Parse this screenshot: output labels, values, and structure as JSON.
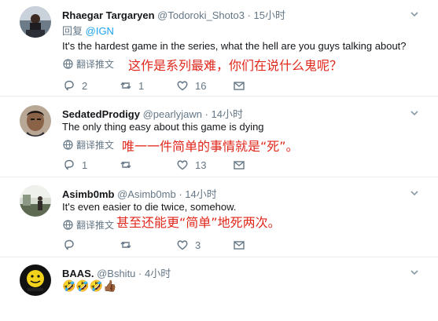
{
  "tweets": [
    {
      "name": "Rhaegar Targaryen",
      "handle": "@Todoroki_Shoto3",
      "dot": "·",
      "time": "15小时",
      "reply_prefix": "回复",
      "reply_mention": "@IGN",
      "text": "It's the hardest game in the series, what the hell are you guys talking about?",
      "translate": "翻译推文",
      "cn": "这作是系列最难，你们在说什么鬼呢？",
      "replies": "2",
      "retweets": "1",
      "likes": "16"
    },
    {
      "name": "SedatedProdigy",
      "handle": "@pearlyjawn",
      "dot": "·",
      "time": "14小时",
      "text": "The only thing easy about this game is dying",
      "translate": "翻译推文",
      "cn": "唯一一件简单的事情就是“死”。",
      "replies": "1",
      "retweets": "",
      "likes": "13"
    },
    {
      "name": "Asimb0mb",
      "handle": "@Asimb0mb",
      "dot": "·",
      "time": "14小时",
      "text": "It's even easier to die twice, somehow.",
      "translate": "翻译推文",
      "cn": "甚至还能更“简单”地死两次。",
      "replies": "",
      "retweets": "",
      "likes": "3"
    },
    {
      "name": "BAAS.",
      "handle": "@Bshitu",
      "dot": "·",
      "time": "4小时",
      "emoji": "🤣🤣🤣👍🏾"
    }
  ],
  "colors": {
    "cn_text": "#e0271b",
    "link": "#1da1f2",
    "muted": "#657786"
  }
}
